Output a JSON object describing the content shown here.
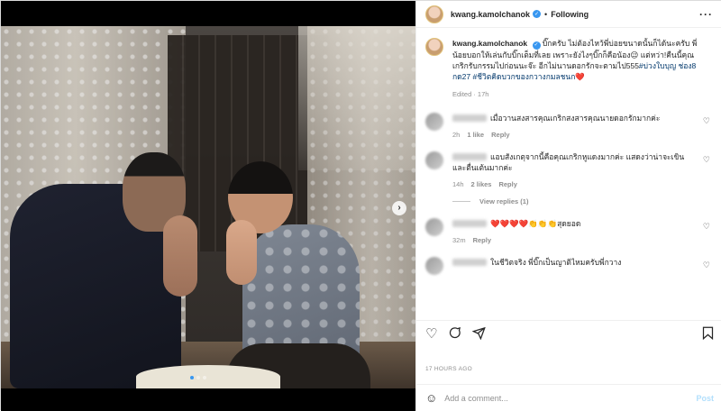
{
  "post": {
    "author": "kwang.kamolchanok",
    "follow_status": "Following",
    "more_icon": "more-horizontal-icon",
    "caption": "บิ๊กครับ ไม่ต้องไหว้พี่บ่อยขนาดนั้นก็ได้นะครับ พี่น้อยบอกให้เล่นกับบิ๊กเต็มที่เลย เพราะยังไงๆบิ๊กก็คือน้อง😉 แต่หว่า!คืนนี้คุณเกริกรับกรรมไปก่อนนะจ๊ะ อีกไม่นานดอกรักจะตามไป555",
    "hashtags": "#บ่วงใบบุญ ช่อง8 กด27 #ชีวิตคิดบวกของกวางกมลชนก❤️",
    "caption_meta": "Edited · 17h",
    "timestamp": "17 HOURS AGO"
  },
  "comments": [
    {
      "text": "เมื่อวานสงสารคุณเกริกสงสารคุณนายดอกรักมากค่ะ",
      "time": "2h",
      "likes": "1 like",
      "reply": "Reply"
    },
    {
      "text": "แอบสังเกตุจากนี้คือคุณเกริกหูแดงมากค่ะ แสดงว่าน่าจะเขินและตื่นเต้นมากค่ะ",
      "time": "14h",
      "likes": "2 likes",
      "reply": "Reply",
      "view_replies": "View replies (1)"
    },
    {
      "text": "❤️❤️❤️❤️👏👏👏สุดยอด",
      "time": "32m",
      "reply": "Reply"
    },
    {
      "text": "ในชีวิตจริง พี่บิ๊กเป็นญาติไหมครับพี่กวาง"
    }
  ],
  "actions": {
    "like_icon": "heart-icon",
    "comment_icon": "comment-icon",
    "share_icon": "share-icon",
    "save_icon": "bookmark-icon"
  },
  "add_comment": {
    "placeholder": "Add a comment...",
    "post_label": "Post",
    "emoji_icon": "emoji-icon"
  },
  "colors": {
    "verified": "#3897f0",
    "link": "#00376b",
    "muted": "#8e8e8e",
    "post_disabled": "#b2dffc"
  }
}
